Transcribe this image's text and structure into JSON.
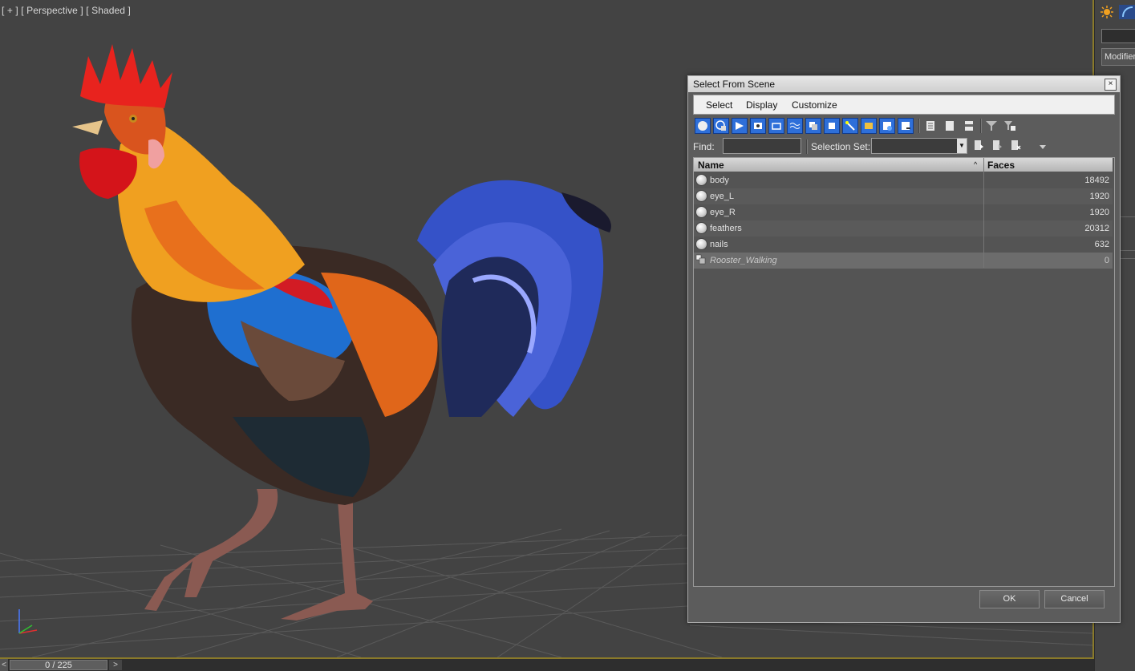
{
  "viewport": {
    "label": "[ + ] [ Perspective ] [ Shaded ]"
  },
  "command_panel": {
    "modifier_label": "Modifier",
    "icons": [
      "sun-icon",
      "arc-icon"
    ]
  },
  "timeline": {
    "frame_display": "0 / 225",
    "prev_glyph": "<",
    "next_glyph": ">"
  },
  "dialog": {
    "title": "Select From Scene",
    "close_glyph": "×",
    "menu": [
      "Select",
      "Display",
      "Customize"
    ],
    "find_label": "Find:",
    "find_value": "",
    "selection_set_label": "Selection Set:",
    "selection_set_value": "",
    "columns": [
      "Name",
      "Faces"
    ],
    "sort_glyph": "^",
    "rows": [
      {
        "name": "body",
        "faces": "18492",
        "icon": "geometry-sphere-icon"
      },
      {
        "name": "eye_L",
        "faces": "1920",
        "icon": "geometry-sphere-icon"
      },
      {
        "name": "eye_R",
        "faces": "1920",
        "icon": "geometry-sphere-icon"
      },
      {
        "name": "feathers",
        "faces": "20312",
        "icon": "geometry-sphere-icon"
      },
      {
        "name": "nails",
        "faces": "632",
        "icon": "geometry-sphere-icon"
      },
      {
        "name": "Rooster_Walking",
        "faces": "0",
        "icon": "group-icon"
      }
    ],
    "ok_label": "OK",
    "cancel_label": "Cancel",
    "toolbar_icons": [
      "geometry-filter-icon",
      "shapes-filter-icon",
      "lights-filter-icon",
      "cameras-filter-icon",
      "helpers-filter-icon",
      "spacewarps-filter-icon",
      "groups-filter-icon",
      "xrefs-filter-icon",
      "bones-filter-icon",
      "containers-filter-icon",
      "frozen-filter-icon",
      "hidden-filter-icon",
      "select-all-icon",
      "select-none-icon",
      "invert-selection-icon",
      "filter-icon",
      "filter-settings-icon"
    ]
  }
}
